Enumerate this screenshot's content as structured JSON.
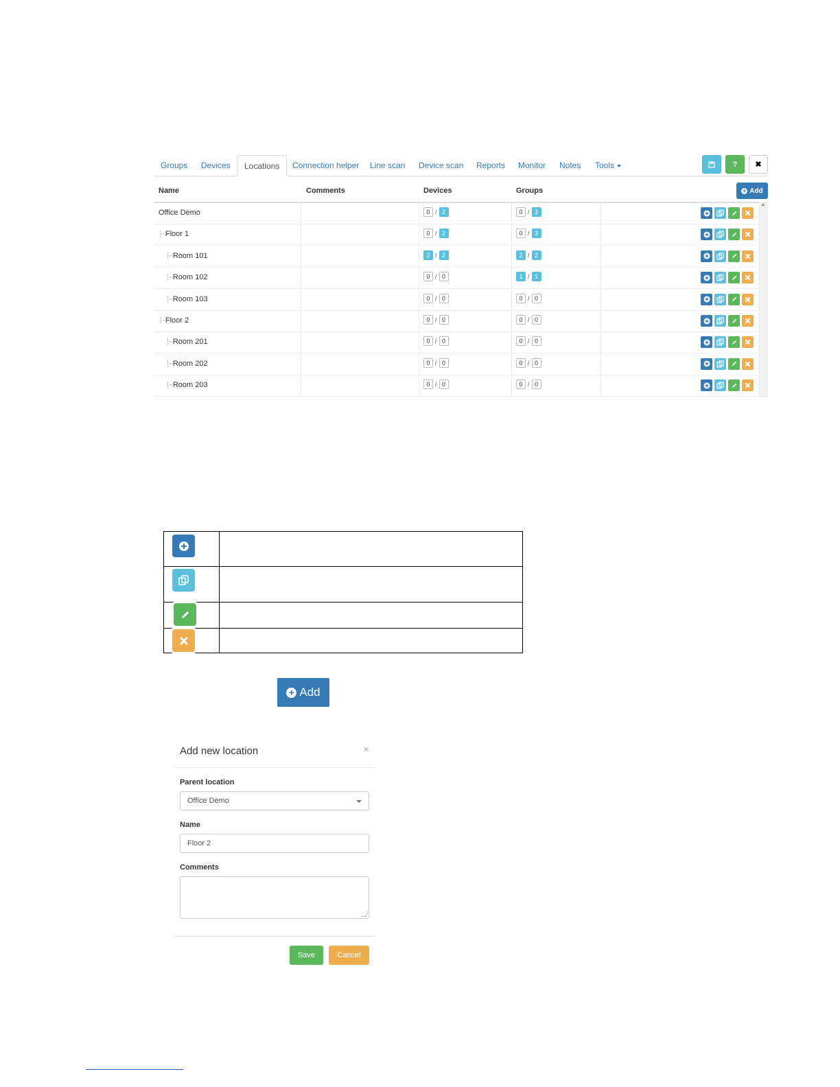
{
  "tabs": [
    "Groups",
    "Devices",
    "Locations",
    "Connection helper",
    "Line scan",
    "Device scan",
    "Reports",
    "Monitor",
    "Notes",
    "Tools"
  ],
  "active_tab": "Locations",
  "toolbar": {
    "save_icon": "floppy-icon",
    "help_label": "?",
    "close_label": "✖"
  },
  "table": {
    "headers": {
      "name": "Name",
      "comments": "Comments",
      "devices": "Devices",
      "groups": "Groups"
    },
    "add_label": "Add",
    "rows": [
      {
        "name": "Office Demo",
        "level": 0,
        "devices": [
          "0",
          "2"
        ],
        "groups": [
          "0",
          "3"
        ]
      },
      {
        "name": "Floor 1",
        "level": 1,
        "devices": [
          "0",
          "2"
        ],
        "groups": [
          "0",
          "3"
        ]
      },
      {
        "name": "Room 101",
        "level": 2,
        "devices": [
          "2",
          "2"
        ],
        "groups": [
          "2",
          "2"
        ]
      },
      {
        "name": "Room 102",
        "level": 2,
        "devices": [
          "0",
          "0"
        ],
        "groups": [
          "1",
          "1"
        ]
      },
      {
        "name": "Room 103",
        "level": 2,
        "devices": [
          "0",
          "0"
        ],
        "groups": [
          "0",
          "0"
        ]
      },
      {
        "name": "Floor 2",
        "level": 1,
        "devices": [
          "0",
          "0"
        ],
        "groups": [
          "0",
          "0"
        ]
      },
      {
        "name": "Room 201",
        "level": 2,
        "devices": [
          "0",
          "0"
        ],
        "groups": [
          "0",
          "0"
        ]
      },
      {
        "name": "Room 202",
        "level": 2,
        "devices": [
          "0",
          "0"
        ],
        "groups": [
          "0",
          "0"
        ]
      },
      {
        "name": "Room 203",
        "level": 2,
        "devices": [
          "0",
          "0"
        ],
        "groups": [
          "0",
          "0"
        ]
      }
    ]
  },
  "legend_icons": [
    "add-child-icon",
    "copy-icon",
    "edit-icon",
    "delete-icon"
  ],
  "big_add_label": "Add",
  "modal": {
    "title": "Add new location",
    "close": "×",
    "parent_label": "Parent location",
    "parent_value": "Office Demo",
    "name_label": "Name",
    "name_value": "Floor 2",
    "comments_label": "Comments",
    "save_label": "Save",
    "cancel_label": "Cancel"
  },
  "colors": {
    "primary": "#337ab7",
    "info": "#5bc0de",
    "success": "#5cb85c",
    "warning": "#f0ad4e"
  }
}
